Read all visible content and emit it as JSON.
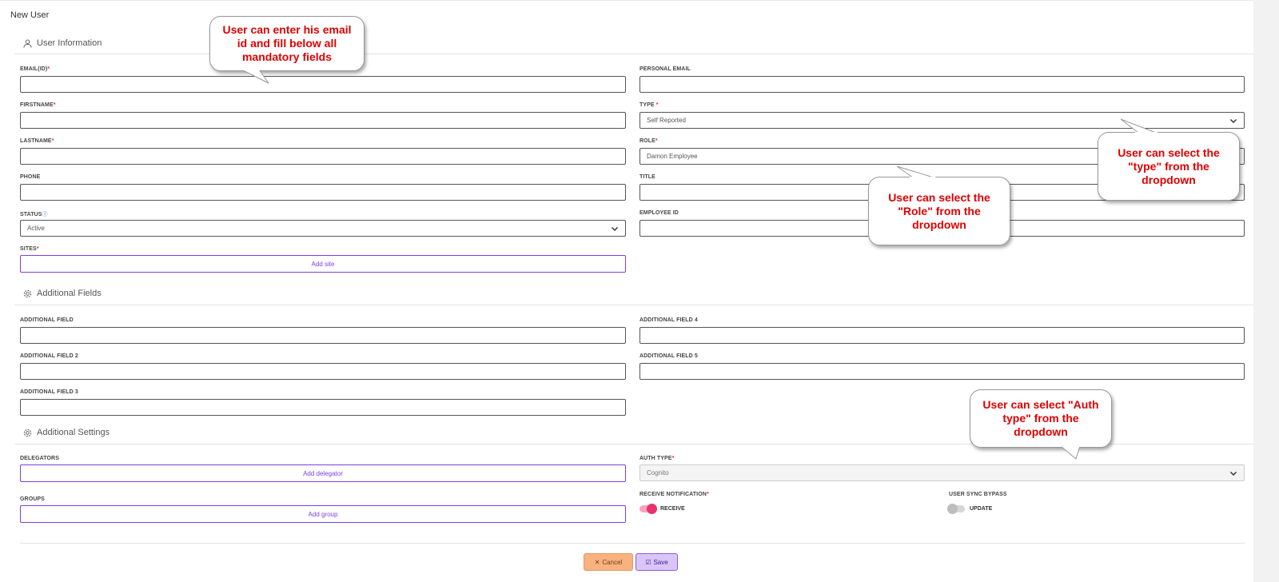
{
  "page": {
    "title": "New User"
  },
  "sections": {
    "user_info": "User Information",
    "additional_fields": "Additional Fields",
    "additional_settings": "Additional Settings"
  },
  "fields": {
    "email": {
      "label": "EMAIL(ID)",
      "value": ""
    },
    "personal_email": {
      "label": "PERSONAL EMAIL",
      "value": ""
    },
    "firstname": {
      "label": "FIRSTNAME",
      "value": ""
    },
    "type": {
      "label": "TYPE",
      "value": "Self Reported"
    },
    "lastname": {
      "label": "LASTNAME",
      "value": ""
    },
    "role": {
      "label": "ROLE",
      "value": "Damon Employee"
    },
    "phone": {
      "label": "PHONE",
      "value": ""
    },
    "title": {
      "label": "TITLE",
      "value": ""
    },
    "status": {
      "label": "STATUS",
      "value": "Active"
    },
    "employee_id": {
      "label": "EMPLOYEE ID",
      "value": ""
    },
    "sites": {
      "label": "SITES",
      "button": "Add site"
    },
    "additional_field": {
      "label": "ADDITIONAL FIELD",
      "value": ""
    },
    "additional_field_4": {
      "label": "ADDITIONAL FIELD 4",
      "value": ""
    },
    "additional_field_2": {
      "label": "ADDITIONAL FIELD 2",
      "value": ""
    },
    "additional_field_5": {
      "label": "ADDITIONAL FIELD 5",
      "value": ""
    },
    "additional_field_3": {
      "label": "ADDITIONAL FIELD 3",
      "value": ""
    },
    "delegators": {
      "label": "DELEGATORS",
      "button": "Add delegator"
    },
    "auth_type": {
      "label": "AUTH TYPE",
      "value": "Cognito"
    },
    "groups": {
      "label": "GROUPS",
      "button": "Add group"
    },
    "receive_notification": {
      "label": "RECEIVE NOTIFICATION",
      "toggle_label": "RECEIVE",
      "on": true
    },
    "user_sync_bypass": {
      "label": "USER SYNC BYPASS",
      "toggle_label": "UPDATE",
      "on": false
    }
  },
  "required_mark": "*",
  "buttons": {
    "cancel": "Cancel",
    "save": "Save"
  },
  "callouts": {
    "email": "User can enter his email id and fill below all mandatory fields",
    "type": "User can select the \"type\" from the dropdown",
    "role": "User can select the \"Role\" from the dropdown",
    "auth": "User can select \"Auth type\" from the dropdown"
  },
  "colors": {
    "accent": "#7b3fe4",
    "required": "#e0245e",
    "toggle_on": "#e8336f",
    "cancel": "#f7b27f",
    "save": "#d9c6f7",
    "callout_text": "#e00000"
  }
}
